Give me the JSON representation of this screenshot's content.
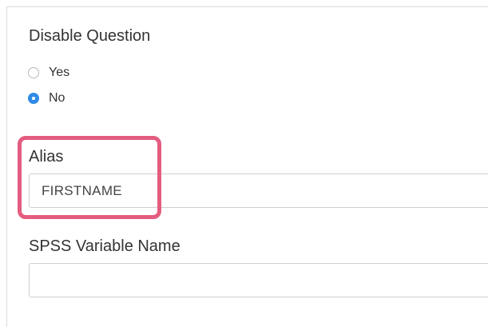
{
  "disable_question": {
    "title": "Disable Question",
    "options": [
      {
        "label": "Yes",
        "selected": false
      },
      {
        "label": "No",
        "selected": true
      }
    ]
  },
  "alias": {
    "label": "Alias",
    "value": "FIRSTNAME"
  },
  "spss": {
    "label": "SPSS Variable Name",
    "value": ""
  },
  "colors": {
    "radio_selected": "#2f8be6",
    "highlight": "#e45d80"
  }
}
